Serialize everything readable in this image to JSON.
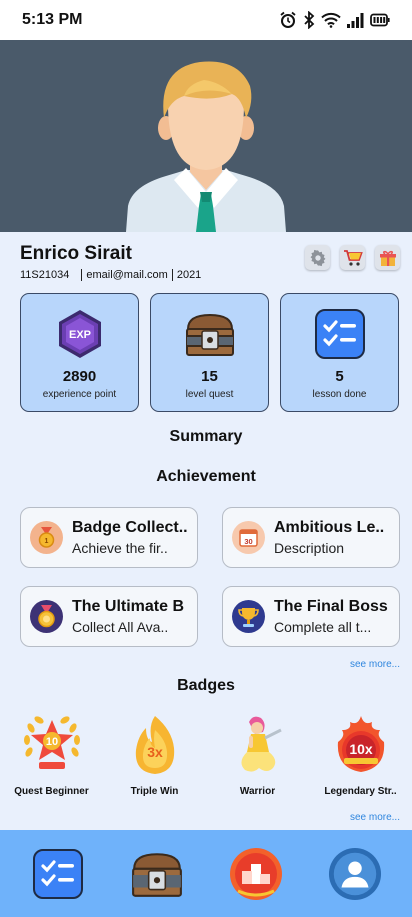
{
  "status": {
    "time": "5:13 PM",
    "battery": ""
  },
  "profile": {
    "name": "Enrico Sirait",
    "student_id": "11S21034",
    "email": "email@mail.com",
    "year": "2021"
  },
  "stats": [
    {
      "value": "2890",
      "label": "experience point",
      "icon_badge": "EXP"
    },
    {
      "value": "15",
      "label": "level quest"
    },
    {
      "value": "5",
      "label": "lesson done"
    }
  ],
  "sections": {
    "summary": "Summary",
    "achievement": "Achievement",
    "badges": "Badges",
    "see_more_achievements": "see more...",
    "see_more_badges": "see more..."
  },
  "achievements": [
    {
      "title": "Badge Collect..",
      "desc": "Achieve the fir..",
      "icon": "medal-icon"
    },
    {
      "title": "Ambitious Le..",
      "desc": "Description",
      "icon": "calendar-30-icon",
      "icon_text": "30"
    },
    {
      "title": "The Ultimate B",
      "desc": "Collect All Ava..",
      "icon": "ribbon-medal-icon"
    },
    {
      "title": "The Final Boss",
      "desc": "Complete all t...",
      "icon": "trophy-icon"
    }
  ],
  "badges": [
    {
      "label": "Quest Beginner",
      "icon_text": "10",
      "icon": "laurel-star-badge-icon"
    },
    {
      "label": "Triple Win",
      "icon_text": "3x",
      "icon": "flame-badge-icon"
    },
    {
      "label": "Warrior",
      "icon": "warrior-figure-icon"
    },
    {
      "label": "Legendary Str..",
      "icon_text": "10x",
      "icon": "fire-badge-icon"
    }
  ],
  "nav": [
    {
      "name": "lessons",
      "icon": "checklist-icon"
    },
    {
      "name": "quests",
      "icon": "treasure-chest-icon"
    },
    {
      "name": "leaderboard",
      "icon": "podium-icon"
    },
    {
      "name": "profile",
      "icon": "user-avatar-icon"
    }
  ],
  "colors": {
    "background": "#e9f0fc",
    "card": "#b8d6fb",
    "nav": "#6fb2fa",
    "hero": "#4a5a6a",
    "link": "#2f86de"
  }
}
